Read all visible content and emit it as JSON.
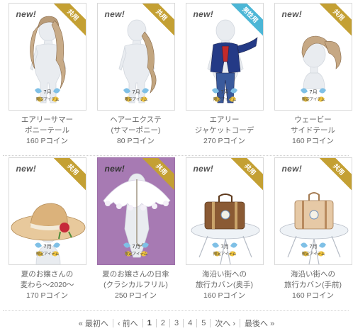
{
  "colors": {
    "ribbon_shared": "#c4a033",
    "ribbon_male": "#4cb6d6",
    "ribbon_female": "#c4a033"
  },
  "badges": {
    "new": "new!",
    "limited_month": "7月",
    "limited_text": "限定アイテム"
  },
  "items": [
    {
      "ribbon": "共用",
      "ribbon_color": "#c4a033",
      "name1": "エアリーサマー",
      "name2": "ポニーテール",
      "price": "160 Pコイン",
      "bg": "white",
      "illustration": "hair-ponytail-icon"
    },
    {
      "ribbon": "共用",
      "ribbon_color": "#c4a033",
      "name1": "ヘアーエクステ",
      "name2": "(サマーポニー)",
      "price": "80 Pコイン",
      "bg": "white",
      "illustration": "hair-extension-icon"
    },
    {
      "ribbon": "男性用",
      "ribbon_color": "#4cb6d6",
      "name1": "エアリー",
      "name2": "ジャケットコーデ",
      "price": "270 Pコイン",
      "bg": "white",
      "illustration": "jacket-outfit-icon"
    },
    {
      "ribbon": "共用",
      "ribbon_color": "#c4a033",
      "name1": "ウェービー",
      "name2": "サイドテール",
      "price": "160 Pコイン",
      "bg": "white",
      "illustration": "hair-sidetail-icon"
    },
    {
      "ribbon": "共用",
      "ribbon_color": "#c4a033",
      "name1": "夏のお嬢さんの",
      "name2": "麦わら～2020～",
      "price": "170 Pコイン",
      "bg": "white",
      "illustration": "straw-hat-icon"
    },
    {
      "ribbon": "共用",
      "ribbon_color": "#c4a033",
      "name1": "夏のお嬢さんの日傘",
      "name2": "(クラシカルフリル)",
      "price": "250 Pコイン",
      "bg": "purple",
      "illustration": "parasol-icon"
    },
    {
      "ribbon": "共用",
      "ribbon_color": "#c4a033",
      "name1": "海沿い街への",
      "name2": "旅行カバン(奥手)",
      "price": "160 Pコイン",
      "bg": "white",
      "illustration": "suitcase-back-icon"
    },
    {
      "ribbon": "共用",
      "ribbon_color": "#c4a033",
      "name1": "海沿い街への",
      "name2": "旅行カバン(手前)",
      "price": "160 Pコイン",
      "bg": "white",
      "illustration": "suitcase-front-icon"
    }
  ],
  "pager": {
    "first": "« 最初へ",
    "prev": "‹ 前へ",
    "pages": [
      "1",
      "2",
      "3",
      "4",
      "5"
    ],
    "current": "1",
    "next": "次へ ›",
    "last": "最後へ »"
  }
}
